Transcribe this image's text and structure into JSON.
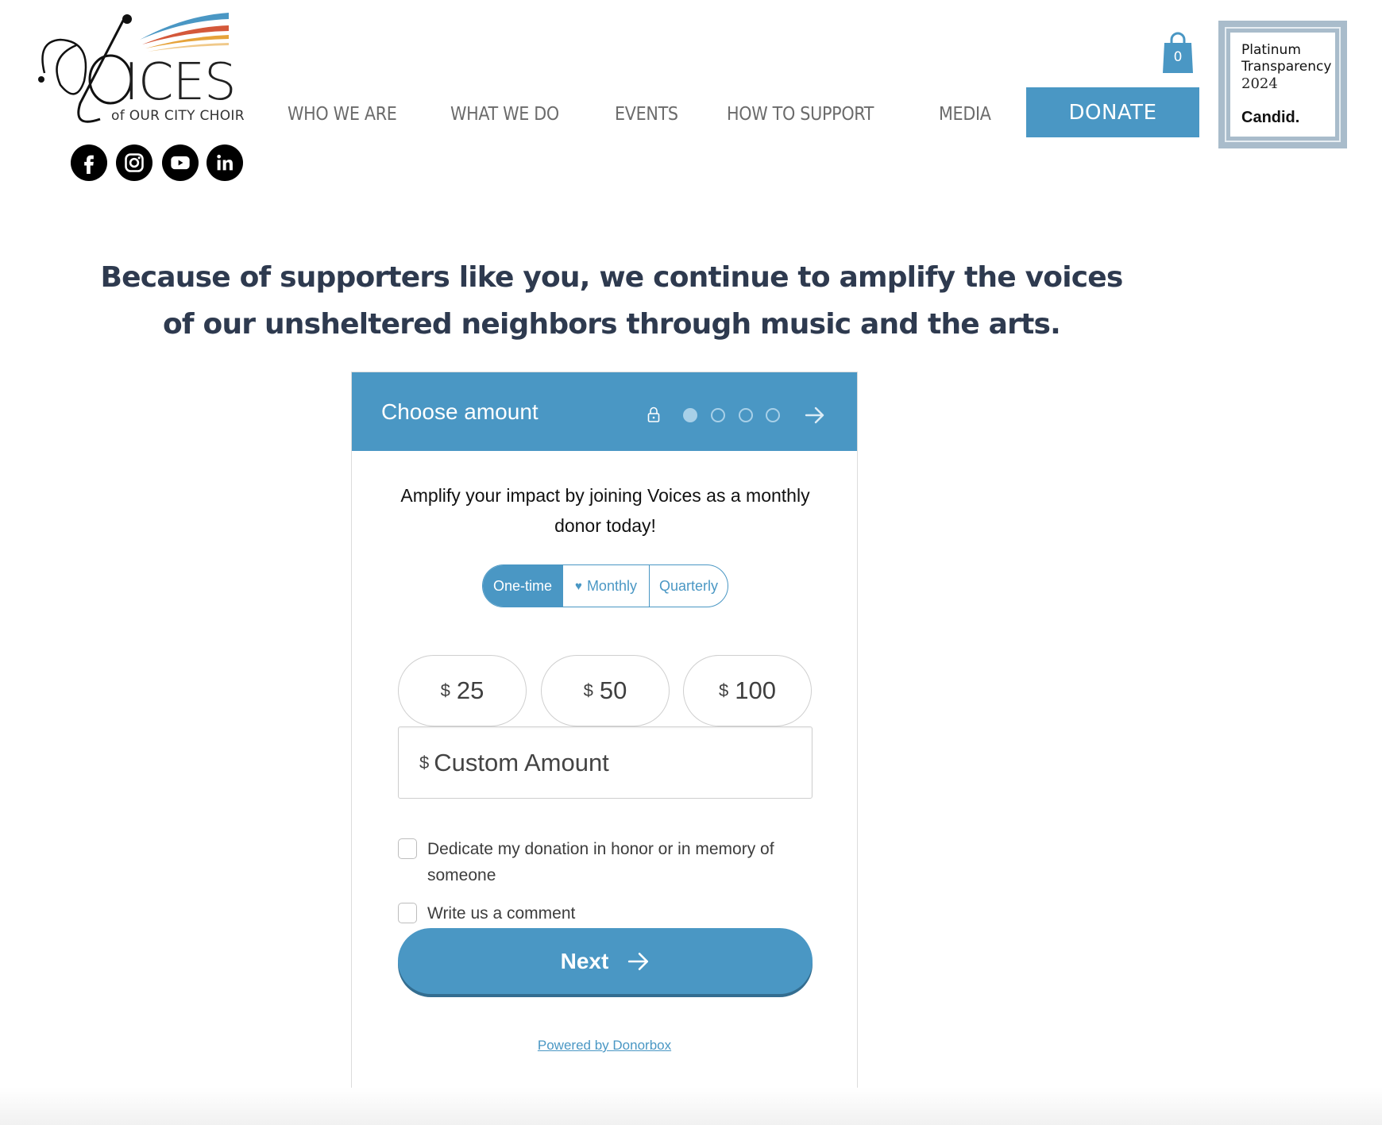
{
  "brand": {
    "logo_word": "ICES",
    "logo_sub": "of OUR CITY CHOIR",
    "logo_colors": [
      "#4a97c4",
      "#d4583a",
      "#e6a33a",
      "#f0c98a"
    ]
  },
  "social": [
    {
      "name": "facebook",
      "icon": "facebook-icon"
    },
    {
      "name": "instagram",
      "icon": "instagram-icon"
    },
    {
      "name": "youtube",
      "icon": "youtube-icon"
    },
    {
      "name": "linkedin",
      "icon": "linkedin-icon"
    }
  ],
  "nav": {
    "items": [
      {
        "label": "WHO WE ARE"
      },
      {
        "label": "WHAT WE DO"
      },
      {
        "label": "EVENTS"
      },
      {
        "label": "HOW TO SUPPORT"
      },
      {
        "label": "MEDIA"
      }
    ],
    "donate_label": "DONATE",
    "cart_count": "0"
  },
  "badge": {
    "line1": "Platinum",
    "line2": "Transparency",
    "year": "2024",
    "brand": "Candid."
  },
  "headline": {
    "line1": "Because of supporters like you, we continue to amplify the voices",
    "line2": "of our unsheltered neighbors through music and the arts."
  },
  "form": {
    "title": "Choose amount",
    "steps_total": 4,
    "step_current": 1,
    "intro": "Amplify your impact by joining Voices as a monthly donor today!",
    "frequency": {
      "options": [
        {
          "label": "One-time",
          "active": true
        },
        {
          "label": "Monthly",
          "icon": "heart-icon",
          "active": false
        },
        {
          "label": "Quarterly",
          "active": false
        }
      ]
    },
    "currency_symbol": "$",
    "amounts": [
      "25",
      "50",
      "100"
    ],
    "custom_placeholder": "Custom Amount",
    "checkboxes": [
      {
        "label": "Dedicate my donation in honor or in memory of someone",
        "checked": false
      },
      {
        "label": "Write us a comment",
        "checked": false
      }
    ],
    "next_label": "Next",
    "powered_by": "Powered by Donorbox"
  },
  "colors": {
    "accent": "#4a97c4",
    "headline": "#2e3a4f",
    "badge_frame": "#a9bccb"
  }
}
